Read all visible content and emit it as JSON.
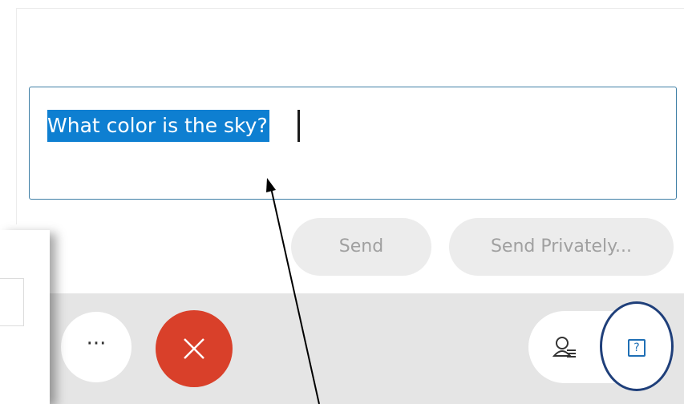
{
  "question_box": {
    "text": "What color is the sky?"
  },
  "buttons": {
    "send_label": "Send",
    "send_private_label": "Send Privately...",
    "more_label": "···",
    "qa_icon_label": "?"
  },
  "icons": {
    "more": "more-options-icon",
    "leave": "close-x-icon",
    "participants": "participants-list-icon",
    "qa": "question-mark-box-icon"
  },
  "colors": {
    "selection": "#0e7fd1",
    "input_border": "#3f7fa6",
    "leave_button": "#d9402a",
    "qa_highlight_ring": "#1f3f7a",
    "disabled_text": "#a0a0a0",
    "toolbar": "#e5e5e5"
  }
}
